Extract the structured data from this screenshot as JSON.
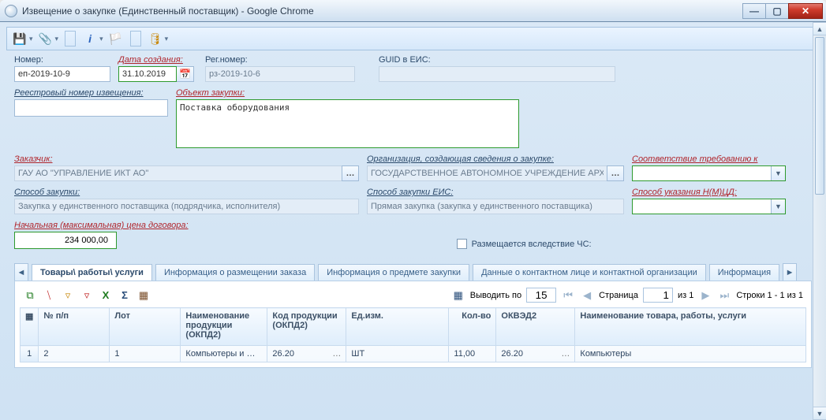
{
  "window": {
    "title": "Извещение о закупке (Единственный поставщик) - Google Chrome"
  },
  "fields": {
    "number_label": "Номер:",
    "number_value": "еп-2019-10-9",
    "create_date_label": "Дата создания:",
    "create_date_value": "31.10.2019",
    "regnum_label": "Рег.номер:",
    "regnum_value": "рз-2019-10-6",
    "guid_label": "GUID в ЕИС:",
    "guid_value": "",
    "registry_label": "Реестровый номер извещения:",
    "registry_value": "",
    "object_label": "Объект закупки:",
    "object_value": "Поставка оборудования",
    "customer_label": "Заказчик:",
    "customer_value": "ГАУ АО \"УПРАВЛЕНИЕ ИКТ АО\"",
    "org_creator_label": "Организация, создающая сведения о закупке:",
    "org_creator_value": "ГОСУДАРСТВЕННОЕ АВТОНОМНОЕ УЧРЕЖДЕНИЕ АРХАН",
    "req_conf_label": "Соответствие требованию к",
    "req_conf_value": "",
    "method_label": "Способ закупки:",
    "method_value": "Закупка у единственного поставщика (подрядчика, исполнителя)",
    "method_eis_label": "Способ закупки ЕИС:",
    "method_eis_value": "Прямая закупка (закупка у единственного поставщика)",
    "nmcd_label": "Способ указания Н(М)ЦД:",
    "nmcd_value": "",
    "nmc_label": "Начальная (максимальная) цена договора:",
    "nmc_value": "234 000,00",
    "chs_label": "Размещается вследствие ЧС:"
  },
  "tabs": {
    "t1": "Товары\\ работы\\ услуги",
    "t2": "Информация о размещении заказа",
    "t3": "Информация о предмете закупки",
    "t4": "Данные о контактном лице и контактной организации",
    "t5": "Информация"
  },
  "pager": {
    "out_label": "Выводить по",
    "page_size": "15",
    "page_label": "Страница",
    "page_cur": "1",
    "page_of": "из 1",
    "rows_info": "Строки 1 - 1 из 1"
  },
  "grid": {
    "headers": {
      "npp": "№ п/п",
      "lot": "Лот",
      "name_okpd2": "Наименование продукции (ОКПД2)",
      "code_okpd2": "Код продукции (ОКПД2)",
      "unit": "Ед.изм.",
      "qty": "Кол-во",
      "okved2": "ОКВЭД2",
      "item_name": "Наименование товара, работы, услуги"
    },
    "rows": [
      {
        "idx": "1",
        "npp": "2",
        "lot": "1",
        "name_okpd2": "Компьютеры и …",
        "code_okpd2": "26.20",
        "unit": "ШТ",
        "qty": "11,00",
        "okved2": "26.20",
        "item_name": "Компьютеры"
      }
    ]
  }
}
